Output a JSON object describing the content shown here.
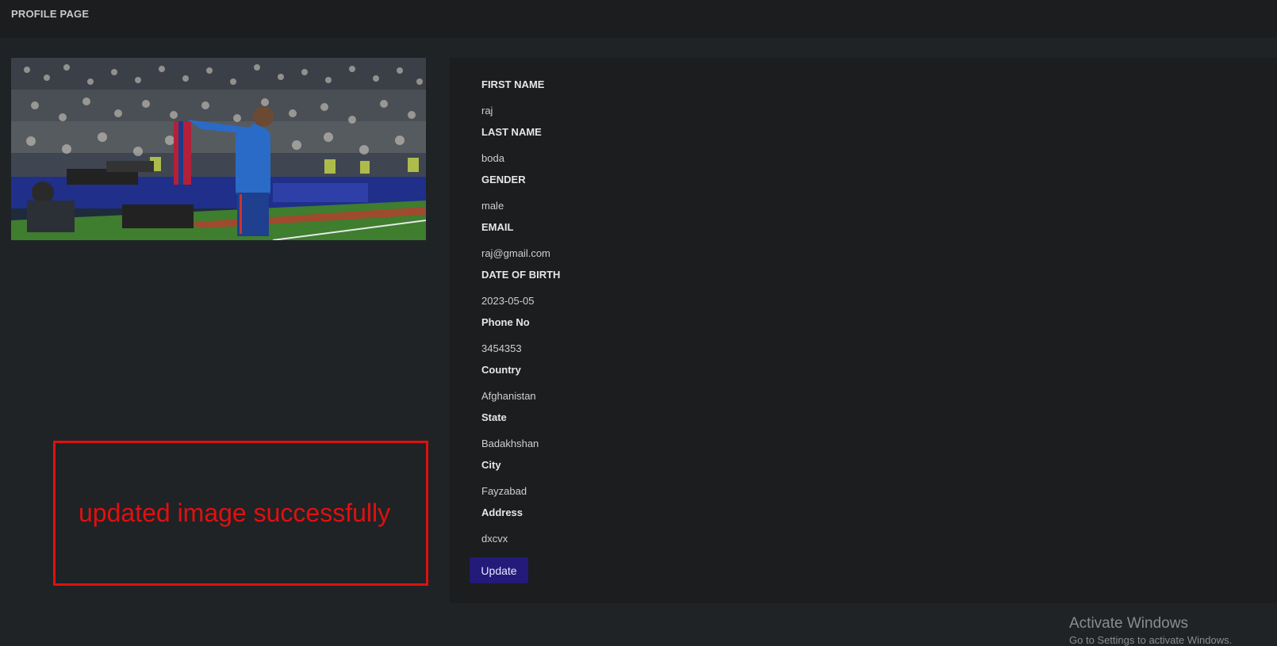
{
  "header": {
    "title": "PROFILE PAGE"
  },
  "profile_image": {
    "description_icon": "profile-photo"
  },
  "fields": [
    {
      "label": "FIRST NAME",
      "value": "raj"
    },
    {
      "label": "LAST NAME",
      "value": "boda"
    },
    {
      "label": "GENDER",
      "value": "male"
    },
    {
      "label": "EMAIL",
      "value": "raj@gmail.com"
    },
    {
      "label": "DATE OF BIRTH",
      "value": "2023-05-05"
    },
    {
      "label": "Phone No",
      "value": "3454353"
    },
    {
      "label": "Country",
      "value": "Afghanistan"
    },
    {
      "label": "State",
      "value": "Badakhshan"
    },
    {
      "label": "City",
      "value": "Fayzabad"
    },
    {
      "label": "Address",
      "value": "dxcvx"
    }
  ],
  "update_button": {
    "label": "Update"
  },
  "annotation": {
    "text": "updated image successfully"
  },
  "watermark": {
    "title": "Activate Windows",
    "subtitle": "Go to Settings to activate Windows."
  },
  "colors": {
    "background": "#1f2325",
    "panel": "#1b1d1f",
    "button": "#231a7a",
    "annotation": "#e01010"
  }
}
